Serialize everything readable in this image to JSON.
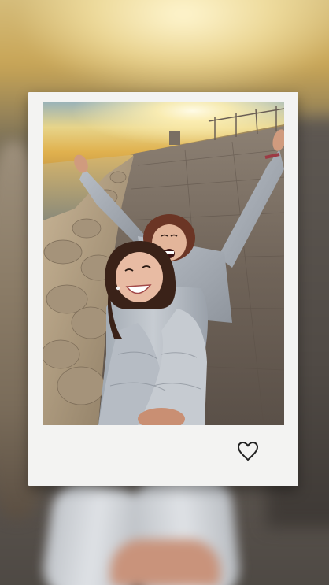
{
  "story": {
    "sticker": "polaroid-frame",
    "action_icon": "heart-outline-icon"
  },
  "colors": {
    "frame": "#f3f3f2",
    "heart_stroke": "#222222"
  }
}
